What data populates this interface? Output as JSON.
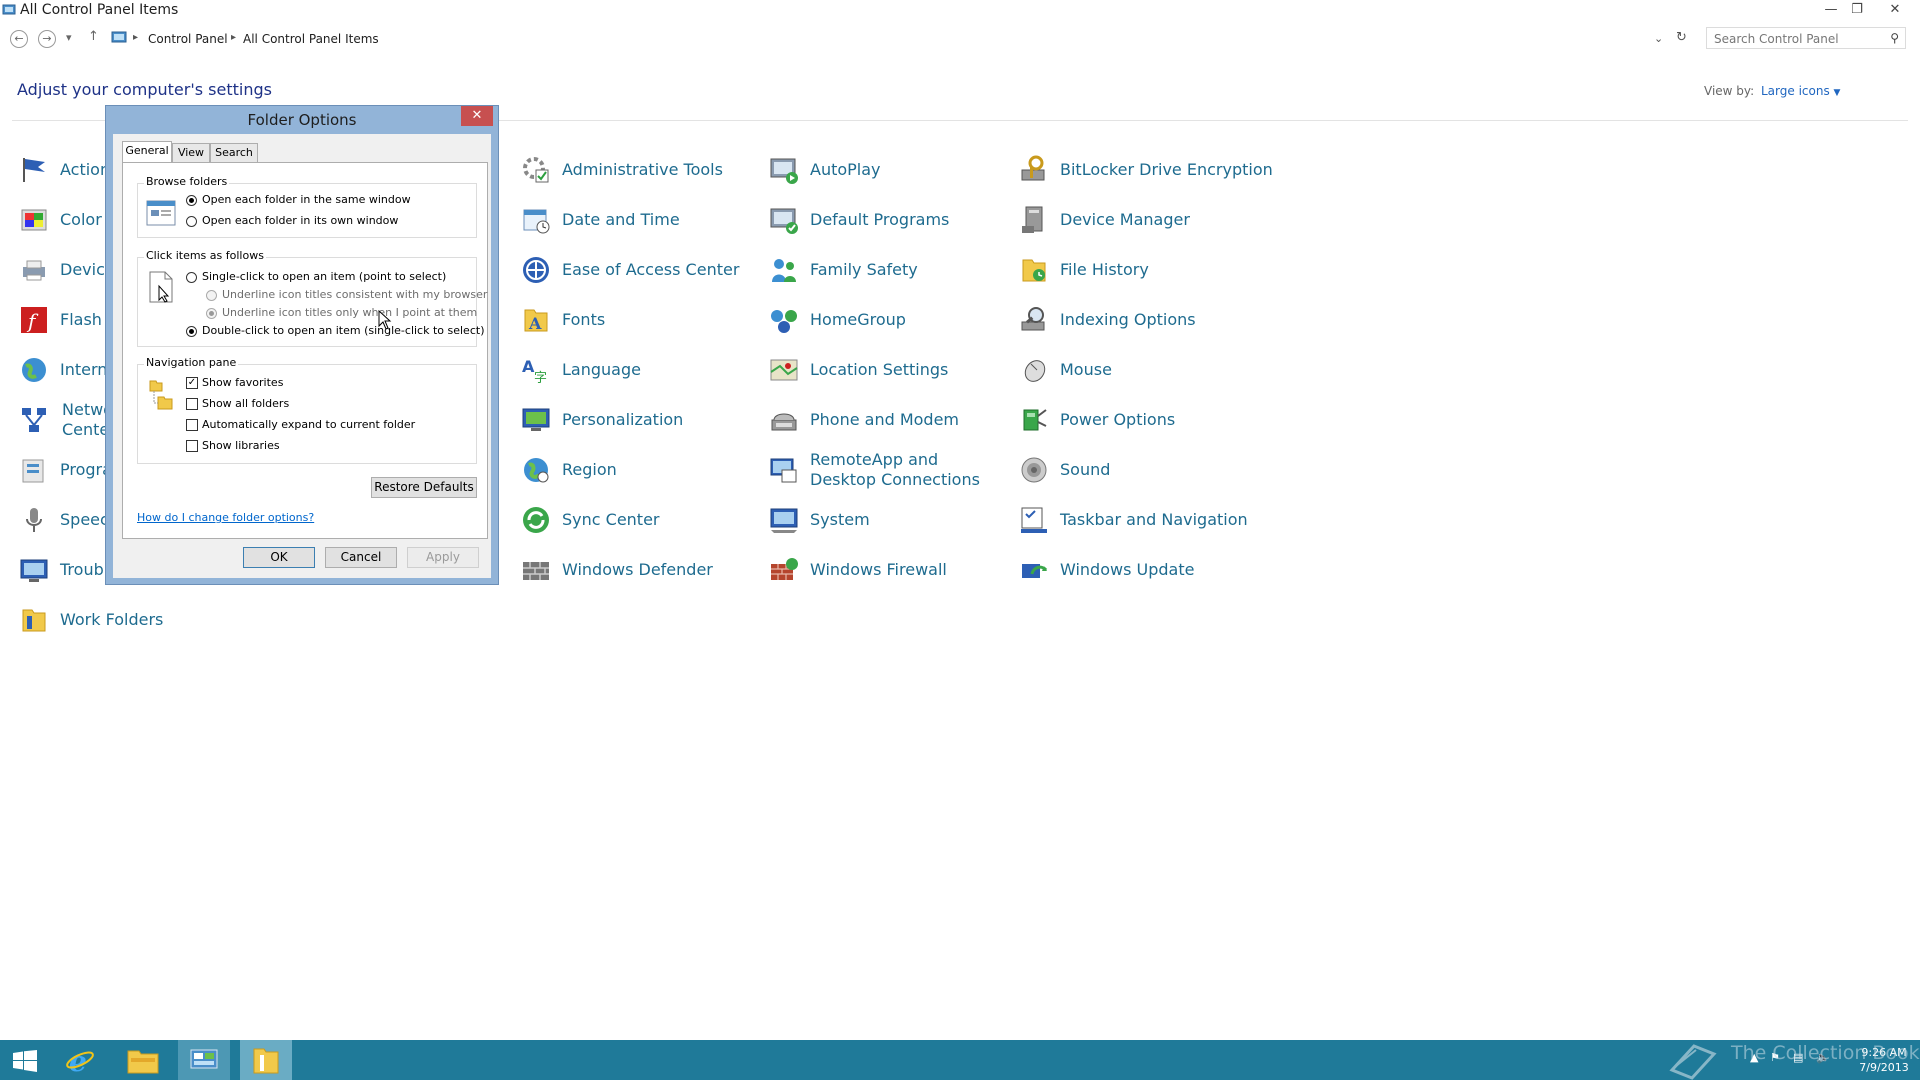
{
  "window": {
    "title": "All Control Panel Items"
  },
  "address": {
    "crumbs": [
      "Control Panel",
      "All Control Panel Items"
    ],
    "search_placeholder": "Search Control Panel"
  },
  "header": {
    "title": "Adjust your computer's settings",
    "view_by_label": "View by:",
    "view_by_value": "Large icons"
  },
  "items_partial": [
    {
      "label": "Action"
    },
    {
      "label": "Color"
    },
    {
      "label": "Device"
    },
    {
      "label": "Flash"
    },
    {
      "label": "Intern"
    },
    {
      "label": "Netwo\nCente"
    },
    {
      "label": "Progra"
    },
    {
      "label": "Speec"
    },
    {
      "label": "Troub"
    }
  ],
  "items_col1_extra": {
    "label": "Work Folders"
  },
  "items_col2": [
    {
      "label": "Administrative Tools"
    },
    {
      "label": "Date and Time"
    },
    {
      "label": "Ease of Access Center"
    },
    {
      "label": "Fonts"
    },
    {
      "label": "Language"
    },
    {
      "label": "Personalization"
    },
    {
      "label": "Region"
    },
    {
      "label": "Sync Center"
    },
    {
      "label": "Windows Defender"
    }
  ],
  "items_col3": [
    {
      "label": "AutoPlay"
    },
    {
      "label": "Default Programs"
    },
    {
      "label": "Family Safety"
    },
    {
      "label": "HomeGroup"
    },
    {
      "label": "Location Settings"
    },
    {
      "label": "Phone and Modem"
    },
    {
      "label": "RemoteApp and Desktop Connections"
    },
    {
      "label": "System"
    },
    {
      "label": "Windows Firewall"
    }
  ],
  "items_col4": [
    {
      "label": "BitLocker Drive Encryption"
    },
    {
      "label": "Device Manager"
    },
    {
      "label": "File History"
    },
    {
      "label": "Indexing Options"
    },
    {
      "label": "Mouse"
    },
    {
      "label": "Power Options"
    },
    {
      "label": "Sound"
    },
    {
      "label": "Taskbar and Navigation"
    },
    {
      "label": "Windows Update"
    }
  ],
  "dialog": {
    "title": "Folder Options",
    "tabs": [
      "General",
      "View",
      "Search"
    ],
    "active_tab": "General",
    "browse": {
      "label": "Browse folders",
      "opt_same": "Open each folder in the same window",
      "opt_own": "Open each folder in its own window",
      "selected": "same"
    },
    "click": {
      "label": "Click items as follows",
      "opt_single": "Single-click to open an item (point to select)",
      "opt_underline_browser": "Underline icon titles consistent with my browser",
      "opt_underline_point": "Underline icon titles only when I point at them",
      "opt_double": "Double-click to open an item (single-click to select)",
      "selected": "double"
    },
    "nav": {
      "label": "Navigation pane",
      "show_favorites": "Show favorites",
      "show_all_folders": "Show all folders",
      "auto_expand": "Automatically expand to current folder",
      "show_libraries": "Show libraries",
      "checked": [
        "show_favorites"
      ]
    },
    "restore_defaults": "Restore Defaults",
    "help_link": "How do I change folder options?",
    "ok": "OK",
    "cancel": "Cancel",
    "apply": "Apply"
  },
  "taskbar": {
    "clock_time": "9:26 AM",
    "clock_date": "7/9/2013",
    "watermark": "The Collection Book"
  }
}
